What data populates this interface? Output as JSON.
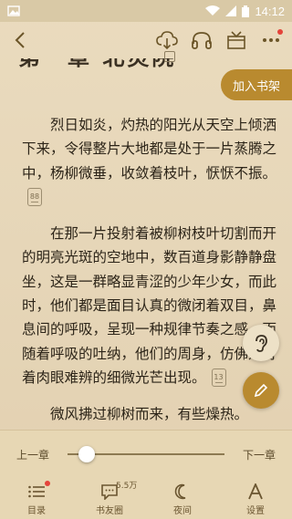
{
  "status_bar": {
    "time": "14:12"
  },
  "chapter": {
    "title": "第一章 北灵院"
  },
  "add_to_shelf": "加入书架",
  "paragraphs": [
    {
      "text": "烈日如炎，灼热的阳光从天空上倾洒下来，令得整片大地都是处于一片蒸腾之中，杨柳微垂，收敛着枝叶，恹恹不振。",
      "comment_count": "88"
    },
    {
      "text": "在那一片投射着被柳树枝叶切割而开的明亮光斑的空地中，数百道身影静静盘坐，这是一群略显青涩的少年少女，而此时，他们都是面目认真的微闭着双目，鼻息间的呼吸，呈现一种规律节奏之感，而随着呼吸的吐纳，他们的周身，仿佛是有着肉眼难辨的细微光芒出现。",
      "comment_count": "13"
    },
    {
      "text": "微风拂过柳树而来，有些燥热。"
    }
  ],
  "progress": {
    "prev": "上一章",
    "next": "下一章",
    "value": 0.08
  },
  "bottom_nav": [
    {
      "label": "目录",
      "icon": "catalog-icon"
    },
    {
      "label": "书友圈",
      "icon": "chat-icon",
      "count": "5.5万"
    },
    {
      "label": "夜间",
      "icon": "moon-icon"
    },
    {
      "label": "设置",
      "icon": "font-icon"
    }
  ],
  "colors": {
    "accent": "#b98a2f",
    "paper": "#e9dcc2",
    "text": "#2c2418"
  }
}
